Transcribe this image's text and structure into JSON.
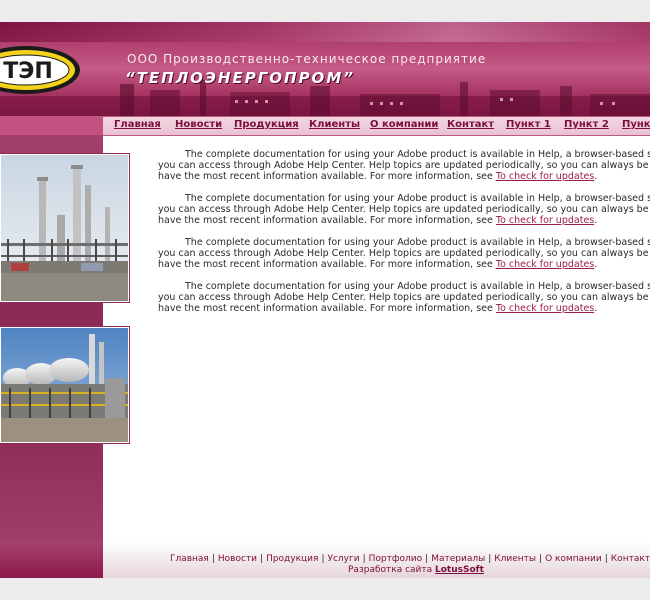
{
  "header": {
    "logo_text": "ТЭП",
    "company_line": "ООО Производственно-техническое предприятие",
    "company_name": "“ТЕПЛОЭНЕРГОПРОМ”"
  },
  "nav": {
    "items": [
      "Главная",
      "Новости",
      "Продукция",
      "Клиенты",
      "О компании",
      "Контакт",
      "Пункт 1",
      "Пункт 2",
      "Пункт"
    ]
  },
  "content": {
    "paragraphs": [
      {
        "line1": "The complete documentation for using your Adobe product is available in Help, a browser-based syst",
        "line2": "you can access through Adobe Help Center. Help topics are updated periodically, so you can always be sure",
        "line3": "have the most recent information available. For more information, see ",
        "link": "To check for updates",
        "end": "."
      },
      {
        "line1": "The complete documentation for using your Adobe product is available in Help, a browser-based syst",
        "line2": "you can access through Adobe Help Center. Help topics are updated periodically, so you can always be sure",
        "line3": "have the most recent information available. For more information, see ",
        "link": "To check for updates",
        "end": "."
      },
      {
        "line1": "The complete documentation for using your Adobe product is available in Help, a browser-based syst",
        "line2": "you can access through Adobe Help Center. Help topics are updated periodically, so you can always be sure",
        "line3": "have the most recent information available. For more information, see ",
        "link": "To check for updates",
        "end": "."
      },
      {
        "line1": "The complete documentation for using your Adobe product is available in Help, a browser-based syst",
        "line2": "you can access through Adobe Help Center. Help topics are updated periodically, so you can always be sure",
        "line3": "have the most recent information available. For more information, see ",
        "link": "To check for updates",
        "end": "."
      }
    ]
  },
  "footer": {
    "links": [
      "Главная",
      "Новости",
      "Продукция",
      "Услуги",
      "Портфолио",
      "Материалы",
      "Клиенты",
      "О компании",
      "Контакт"
    ],
    "separator": "|",
    "dev_prefix": "Разработка сайта ",
    "dev_name": "LotusSoft"
  },
  "colors": {
    "brand": "#8c1a4c",
    "link": "#9b1c4e",
    "nav_bg": "#f3d6e2"
  },
  "icons": [
    "logo-emblem",
    "industrial-plant-photo",
    "gas-processing-photo"
  ]
}
